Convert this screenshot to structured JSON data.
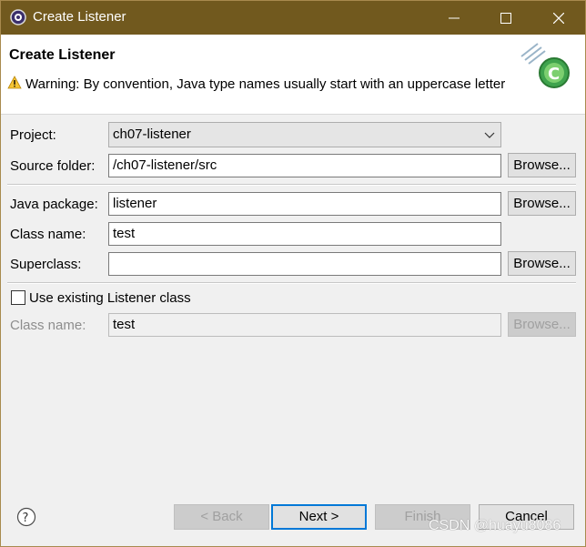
{
  "window": {
    "title": "Create Listener"
  },
  "header": {
    "title": "Create Listener",
    "warning": "Warning: By convention, Java type names usually start with an uppercase letter"
  },
  "form": {
    "project": {
      "label": "Project:",
      "value": "ch07-listener"
    },
    "source_folder": {
      "label": "Source folder:",
      "value": "/ch07-listener/src",
      "browse": "Browse..."
    },
    "java_package": {
      "label": "Java package:",
      "value": "listener",
      "browse": "Browse..."
    },
    "class_name": {
      "label": "Class name:",
      "value": "test"
    },
    "superclass": {
      "label": "Superclass:",
      "value": "",
      "browse": "Browse..."
    },
    "use_existing": {
      "label": "Use existing Listener class",
      "checked": false
    },
    "existing_class_name": {
      "label": "Class name:",
      "value": "test",
      "browse": "Browse..."
    }
  },
  "buttons": {
    "back": "< Back",
    "next": "Next >",
    "finish": "Finish",
    "cancel": "Cancel"
  },
  "watermark": "CSDN @huayu8086",
  "colors": {
    "titlebar": "#71591e",
    "default_button_border": "#0078d7"
  }
}
